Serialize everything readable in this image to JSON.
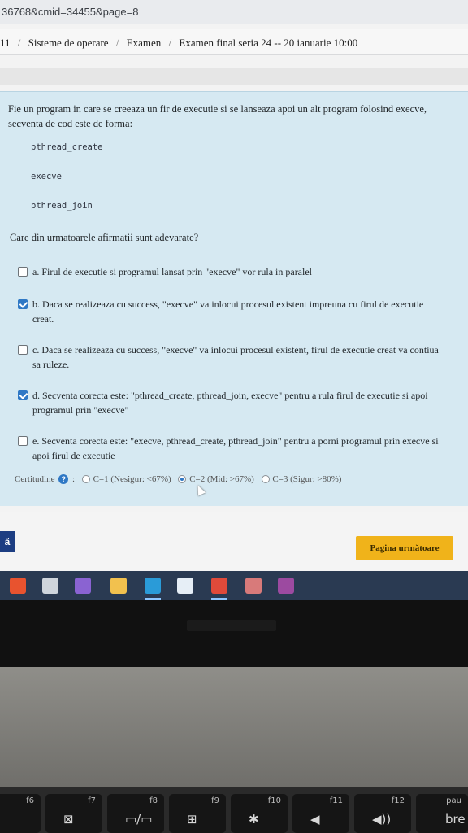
{
  "browser": {
    "url_fragment": "36768&cmid=34455&page=8"
  },
  "breadcrumb": {
    "items": [
      "11",
      "Sisteme de operare",
      "Examen",
      "Examen final seria 24 -- 20 ianuarie 10:00"
    ],
    "separator": "/"
  },
  "question": {
    "text": "Fie un program in care se creeaza un fir de executie si se lanseaza apoi un alt program folosind execve, secventa de cod este de forma:",
    "code_lines": [
      "pthread_create",
      "execve",
      "pthread_join"
    ],
    "prompt": "Care din urmatoarele afirmatii sunt adevarate?",
    "answers": [
      {
        "label": "a. Firul de executie si programul lansat prin \"execve\" vor rula in paralel",
        "checked": false
      },
      {
        "label": "b. Daca se realizeaza cu success, \"execve\" va inlocui procesul existent impreuna cu firul de executie creat.",
        "checked": true
      },
      {
        "label": "c. Daca se realizeaza cu success, \"execve\" va inlocui procesul existent, firul de executie creat va contiua sa ruleze.",
        "checked": false
      },
      {
        "label": "d. Secventa corecta este: \"pthread_create, pthread_join, execve\" pentru a rula firul de executie si apoi programul prin \"execve\"",
        "checked": true
      },
      {
        "label": "e. Secventa corecta este: \"execve, pthread_create, pthread_join\" pentru a porni programul prin execve si apoi firul de executie",
        "checked": false
      }
    ]
  },
  "certitude": {
    "label": "Certitudine",
    "colon": ":",
    "options": [
      {
        "label": "C=1 (Nesigur: <67%)",
        "selected": false
      },
      {
        "label": "C=2 (Mid: >67%)",
        "selected": true
      },
      {
        "label": "C=3 (Sigur: >80%)",
        "selected": false
      }
    ]
  },
  "navigation": {
    "prev_label": "ă",
    "next_label": "Pagina următoare"
  },
  "taskbar": {
    "icons": [
      {
        "name": "office-icon",
        "color": "#e8532f"
      },
      {
        "name": "store-icon",
        "color": "#cfd5dc"
      },
      {
        "name": "visual-studio-icon",
        "color": "#8a63d2"
      },
      {
        "name": "file-explorer-icon",
        "color": "#f2c14e"
      },
      {
        "name": "edge-icon",
        "color": "#2a9bd8"
      },
      {
        "name": "app-icon",
        "color": "#e6eef6"
      },
      {
        "name": "chrome-icon",
        "color": "#e04a3a"
      },
      {
        "name": "app2-icon",
        "color": "#d87a7a"
      },
      {
        "name": "winrar-icon",
        "color": "#9c4aa0"
      }
    ]
  },
  "keyboard": {
    "keys": [
      {
        "label": "f6",
        "glyph": ""
      },
      {
        "label": "f7",
        "glyph": "⊠"
      },
      {
        "label": "f8",
        "glyph": "▭/▭"
      },
      {
        "label": "f9",
        "glyph": "⊞"
      },
      {
        "label": "f10",
        "glyph": "✱"
      },
      {
        "label": "f11",
        "glyph": "◀"
      },
      {
        "label": "f12",
        "glyph": "◀))"
      },
      {
        "label": "pau",
        "glyph": "bre"
      }
    ]
  }
}
